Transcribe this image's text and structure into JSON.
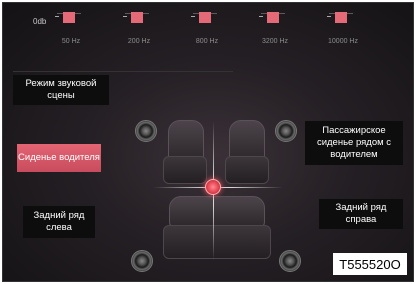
{
  "equalizer": {
    "level_label": "0db",
    "bands": [
      "50 Hz",
      "200 Hz",
      "800 Hz",
      "3200 Hz",
      "10000 Hz"
    ]
  },
  "zones": {
    "sound_mode": "Режим звуковой сцены",
    "driver_seat": "Сиденье водителя",
    "passenger_seat": "Пассажирское сиденье рядом с водителем",
    "rear_left": "Задний ряд слева",
    "rear_right": "Задний ряд справа"
  },
  "figure_code": "T555520O",
  "colors": {
    "accent": "#e46574",
    "background": "#1e1a1e"
  }
}
